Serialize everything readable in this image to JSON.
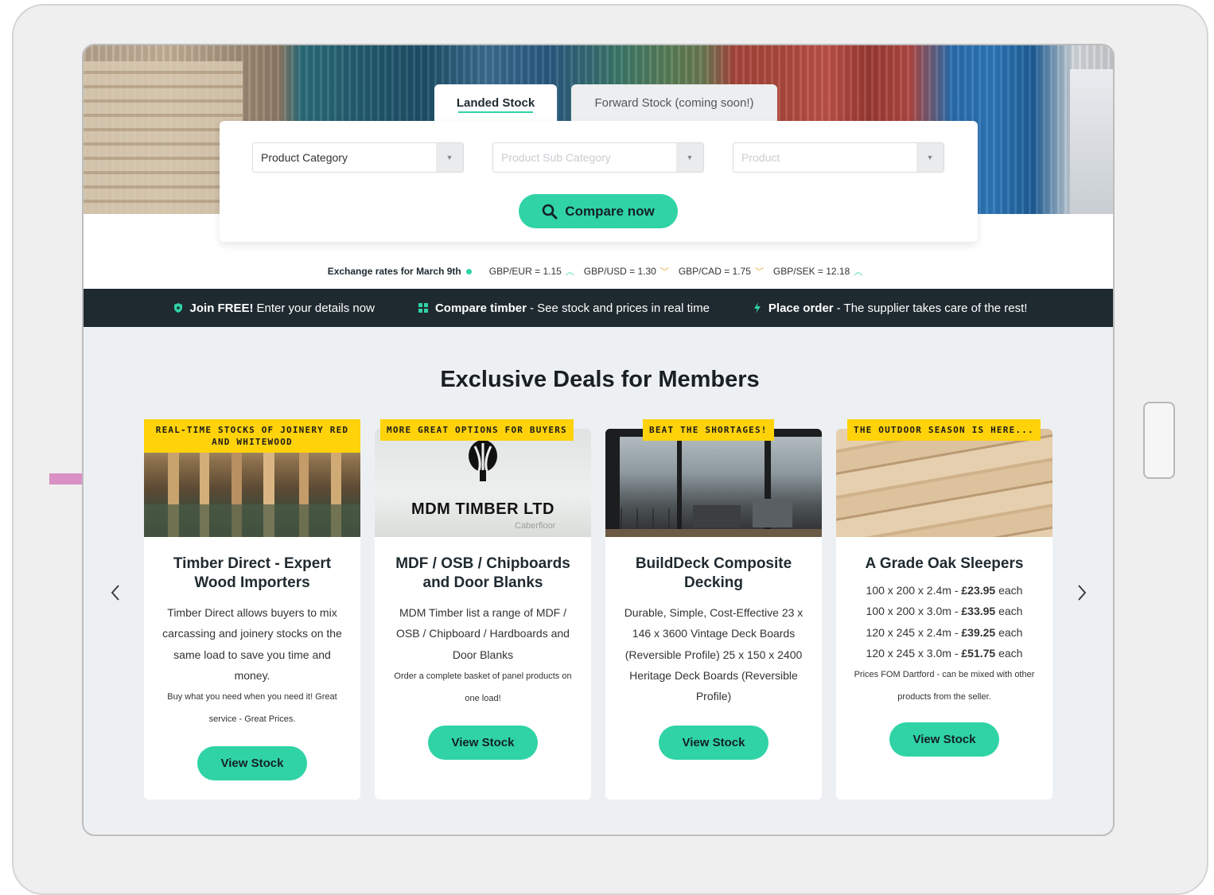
{
  "tabs": {
    "landed": "Landed Stock",
    "forward": "Forward Stock (coming soon!)"
  },
  "search": {
    "category": "Product Category",
    "sub_category": "Product Sub Category",
    "product": "Product",
    "compare_label": "Compare now"
  },
  "rates": {
    "label": "Exchange rates for March 9th",
    "items": [
      {
        "text": "GBP/EUR = 1.15",
        "trend": "up"
      },
      {
        "text": "GBP/USD = 1.30",
        "trend": "down"
      },
      {
        "text": "GBP/CAD = 1.75",
        "trend": "down"
      },
      {
        "text": "GBP/SEK = 12.18",
        "trend": "up"
      }
    ]
  },
  "features": [
    {
      "bold": "Join FREE!",
      "text": "Enter your details now"
    },
    {
      "bold": "Compare timber",
      "text": "- See stock and prices in real time"
    },
    {
      "bold": "Place order",
      "text": "- The supplier takes care of the rest!"
    }
  ],
  "section_title": "Exclusive Deals for Members",
  "cards": [
    {
      "badge": "REAL-TIME STOCKS OF JOINERY RED AND WHITEWOOD",
      "title": "Timber Direct - Expert Wood Importers",
      "body": "Timber Direct allows buyers to mix carcassing and joinery stocks on the same load to save you time and money.",
      "small": "Buy what you need when you need it! Great service - Great Prices.",
      "button": "View Stock"
    },
    {
      "badge": "MORE GREAT OPTIONS FOR BUYERS",
      "image_text": "MDM TIMBER LTD",
      "image_sub": "Caberfloor",
      "title": "MDF / OSB / Chipboards and Door Blanks",
      "body": "MDM Timber list a range of MDF / OSB / Chipboard / Hardboards and Door Blanks",
      "small": "Order a complete basket of panel products on one load!",
      "button": "View Stock"
    },
    {
      "badge": "BEAT THE SHORTAGES!",
      "title": "BuildDeck Composite Decking",
      "body": "Durable, Simple, Cost-Effective 23 x 146 x 3600 Vintage Deck Boards (Reversible Profile) 25 x 150 x 2400 Heritage Deck Boards (Reversible Profile)",
      "button": "View Stock"
    },
    {
      "badge": "THE OUTDOOR SEASON IS HERE...",
      "title": "A Grade Oak Sleepers",
      "prices": [
        {
          "size": "100 x 200 x 2.4m - ",
          "price": "£23.95",
          "unit": " each"
        },
        {
          "size": "100 x 200 x 3.0m - ",
          "price": "£33.95",
          "unit": " each"
        },
        {
          "size": "120 x 245 x 2.4m - ",
          "price": "£39.25",
          "unit": " each"
        },
        {
          "size": "120 x 245 x 3.0m - ",
          "price": "£51.75",
          "unit": " each"
        }
      ],
      "small": "Prices FOM Dartford - can be mixed with other products from the seller.",
      "button": "View Stock"
    }
  ],
  "icons": {
    "search": "search-icon",
    "shield": "shield-icon",
    "grid": "grid-icon",
    "bolt": "bolt-icon",
    "prev": "chevron-left-icon",
    "next": "chevron-right-icon",
    "pointer": "arrow-right-icon"
  },
  "colors": {
    "accent": "#2fd3a6",
    "dark": "#1f2a30",
    "badge": "#ffd20a",
    "pointer": "#d990c4"
  }
}
